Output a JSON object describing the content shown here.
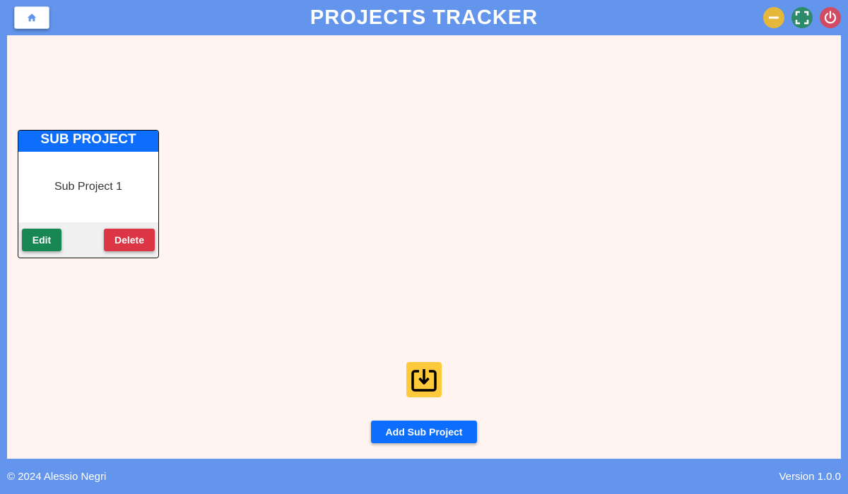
{
  "header": {
    "title": "PROJECTS TRACKER",
    "home_icon": "home-icon",
    "controls": [
      {
        "name": "minimize",
        "icon": "minus-icon",
        "color": "#e5b83b"
      },
      {
        "name": "maximize",
        "icon": "fullscreen-icon",
        "color": "#2e8b6a"
      },
      {
        "name": "close",
        "icon": "power-icon",
        "color": "#d14b63"
      }
    ]
  },
  "card": {
    "header": "SUB PROJECT",
    "name": "Sub Project 1",
    "edit_label": "Edit",
    "delete_label": "Delete"
  },
  "main": {
    "import_icon": "import-icon",
    "add_label": "Add Sub Project"
  },
  "footer": {
    "copyright": "© 2024 Alessio Negri",
    "version": "Version 1.0.0"
  },
  "colors": {
    "frame": "#6495ed",
    "content_bg": "#fff4ef",
    "primary": "#0d6efd",
    "success": "#198754",
    "danger": "#dc3545",
    "warning": "#ffc93c"
  }
}
